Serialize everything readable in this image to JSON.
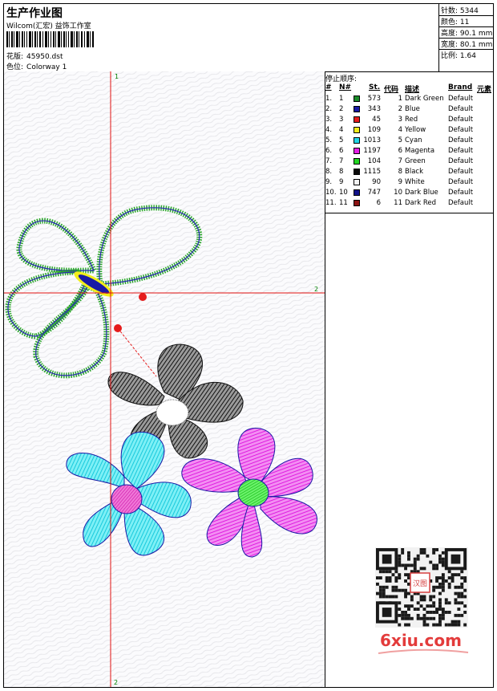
{
  "header": {
    "title": "生产作业图",
    "company": "Wilcom(汇宏) 益饰工作室",
    "file_label": "花版:",
    "file_name": "45950.dst",
    "color_label": "色位:",
    "colorway": "Colorway 1"
  },
  "stats": [
    {
      "label": "针数:",
      "value": "5344"
    },
    {
      "label": "颜色:",
      "value": "11"
    },
    {
      "label": "高度:",
      "value": "90.1 mm"
    },
    {
      "label": "宽度:",
      "value": "80.1 mm"
    },
    {
      "label": "比例:",
      "value": "1.64"
    }
  ],
  "stop_sequence": {
    "title": "停止顺序:",
    "columns": [
      "#",
      "N#",
      "St.",
      "代码",
      "描述",
      "Brand",
      "元素"
    ],
    "rows": [
      {
        "num": "1.",
        "n": "1",
        "st": "573",
        "code": "1",
        "desc": "Dark Green",
        "brand": "Default",
        "color": "#1c8c2a"
      },
      {
        "num": "2.",
        "n": "2",
        "st": "343",
        "code": "2",
        "desc": "Blue",
        "brand": "Default",
        "color": "#1a1aa6"
      },
      {
        "num": "3.",
        "n": "3",
        "st": "45",
        "code": "3",
        "desc": "Red",
        "brand": "Default",
        "color": "#e51c1c"
      },
      {
        "num": "4.",
        "n": "4",
        "st": "109",
        "code": "4",
        "desc": "Yellow",
        "brand": "Default",
        "color": "#f2ee1a"
      },
      {
        "num": "5.",
        "n": "5",
        "st": "1013",
        "code": "5",
        "desc": "Cyan",
        "brand": "Default",
        "color": "#22d6e6"
      },
      {
        "num": "6.",
        "n": "6",
        "st": "1197",
        "code": "6",
        "desc": "Magenta",
        "brand": "Default",
        "color": "#e61ee6"
      },
      {
        "num": "7.",
        "n": "7",
        "st": "104",
        "code": "7",
        "desc": "Green",
        "brand": "Default",
        "color": "#22d622"
      },
      {
        "num": "8.",
        "n": "8",
        "st": "1115",
        "code": "8",
        "desc": "Black",
        "brand": "Default",
        "color": "#0a0a0a"
      },
      {
        "num": "9.",
        "n": "9",
        "st": "90",
        "code": "9",
        "desc": "White",
        "brand": "Default",
        "color": "#f4f4f4"
      },
      {
        "num": "10.",
        "n": "10",
        "st": "747",
        "code": "10",
        "desc": "Dark Blue",
        "brand": "Default",
        "color": "#12128a"
      },
      {
        "num": "11.",
        "n": "11",
        "st": "6",
        "code": "11",
        "desc": "Dark Red",
        "brand": "Default",
        "color": "#8c1414"
      }
    ]
  },
  "canvas": {
    "axis_labels": {
      "top": "1",
      "right": "2",
      "bottom": "2"
    },
    "crosshair_color": "#e01010"
  },
  "watermark": {
    "text": "6xiu.com",
    "qr_seal": "汉图"
  }
}
